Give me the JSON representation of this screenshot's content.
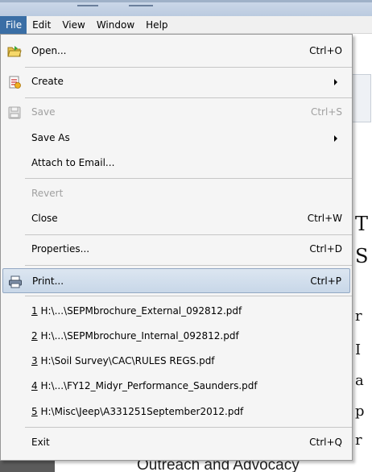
{
  "menubar": {
    "items": [
      {
        "label": "File",
        "active": true
      },
      {
        "label": "Edit"
      },
      {
        "label": "View"
      },
      {
        "label": "Window"
      },
      {
        "label": "Help"
      }
    ]
  },
  "file_menu": {
    "open": {
      "label": "Open...",
      "shortcut": "Ctrl+O",
      "icon": "open-folder-icon"
    },
    "create": {
      "label": "Create",
      "icon": "create-pdf-icon",
      "submenu": true
    },
    "save": {
      "label": "Save",
      "shortcut": "Ctrl+S",
      "icon": "save-disk-icon",
      "disabled": true
    },
    "save_as": {
      "label": "Save As",
      "submenu": true
    },
    "attach": {
      "label": "Attach to Email..."
    },
    "revert": {
      "label": "Revert",
      "disabled": true
    },
    "close": {
      "label": "Close",
      "shortcut": "Ctrl+W"
    },
    "properties": {
      "label": "Properties...",
      "shortcut": "Ctrl+D"
    },
    "print": {
      "label": "Print...",
      "shortcut": "Ctrl+P",
      "icon": "printer-icon",
      "highlighted": true
    },
    "recent": [
      {
        "number": "1",
        "label": "H:\\...\\SEPMbrochure_External_092812.pdf"
      },
      {
        "number": "2",
        "label": "H:\\...\\SEPMbrochure_Internal_092812.pdf"
      },
      {
        "number": "3",
        "label": "H:\\Soil Survey\\CAC\\RULES  REGS.pdf"
      },
      {
        "number": "4",
        "label": "H:\\...\\FY12_Midyr_Performance_Saunders.pdf"
      },
      {
        "number": "5",
        "label": "H:\\Misc\\Jeep\\A331251September2012.pdf"
      }
    ],
    "exit": {
      "label": "Exit",
      "shortcut": "Ctrl+Q"
    }
  },
  "background": {
    "bottom_text": "Outreach and Advocacy",
    "right_glyphs": [
      "T",
      "S",
      "r",
      "I",
      "a",
      "p",
      "r",
      "p"
    ]
  },
  "colors": {
    "menu_active": "#3a6ea5",
    "highlight": "#c8d7e8",
    "disabled_text": "#a0a0a0"
  }
}
